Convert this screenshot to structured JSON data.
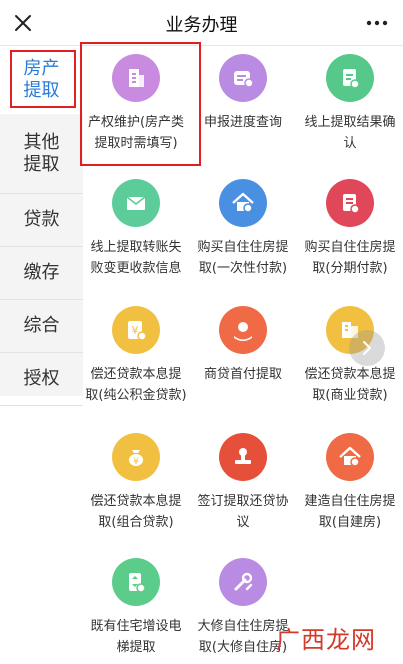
{
  "header": {
    "title": "业务办理",
    "close_icon": "close-icon",
    "more_icon": "more-icon"
  },
  "sidebar": {
    "items": [
      {
        "label": "房产提取",
        "active": true
      },
      {
        "label": "其他提取",
        "active": false
      },
      {
        "label": "贷款",
        "active": false
      },
      {
        "label": "缴存",
        "active": false
      },
      {
        "label": "综合",
        "active": false
      },
      {
        "label": "授权",
        "active": false
      }
    ]
  },
  "services": [
    {
      "label": "产权维护(房产类提取时需填写)",
      "icon": "building-icon",
      "color": "#c98be0"
    },
    {
      "label": "申报进度查询",
      "icon": "progress-list-icon",
      "color": "#b98be2"
    },
    {
      "label": "线上提取结果确认",
      "icon": "clipboard-check-icon",
      "color": "#56c98a"
    },
    {
      "label": "线上提取转账失败变更收款信息",
      "icon": "envelope-icon",
      "color": "#5ccc9a"
    },
    {
      "label": "购买自住住房提取(一次性付款)",
      "icon": "house-icon",
      "color": "#4a90e2"
    },
    {
      "label": "购买自住住房提取(分期付款)",
      "icon": "document-edit-icon",
      "color": "#e0485a"
    },
    {
      "label": "偿还贷款本息提取(纯公积金贷款)",
      "icon": "yuan-document-icon",
      "color": "#f2c040"
    },
    {
      "label": "商贷首付提取",
      "icon": "hand-person-icon",
      "color": "#f06a45"
    },
    {
      "label": "偿还贷款本息提取(商业贷款)",
      "icon": "buildings-icon",
      "color": "#f2c040"
    },
    {
      "label": "偿还贷款本息提取(组合贷款)",
      "icon": "money-bag-icon",
      "color": "#f2c040"
    },
    {
      "label": "签订提取还贷协议",
      "icon": "stamp-icon",
      "color": "#e6503a"
    },
    {
      "label": "建造自住住房提取(自建房)",
      "icon": "house-icon",
      "color": "#f06a45"
    },
    {
      "label": "既有住宅增设电梯提取",
      "icon": "elevator-icon",
      "color": "#5ccc8a"
    },
    {
      "label": "大修自住住房提取(大修自住房)",
      "icon": "wrench-icon",
      "color": "#b98be2"
    }
  ],
  "watermark": {
    "text": "广西龙网"
  }
}
